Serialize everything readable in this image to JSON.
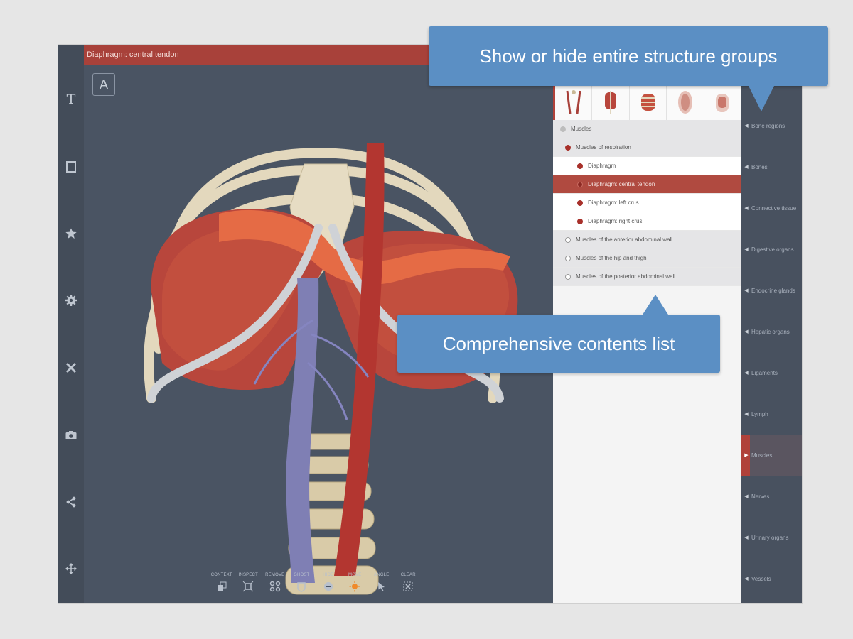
{
  "title_bar": {
    "label": "Diaphragm: central tendon"
  },
  "toolbar_left": {
    "icons": [
      "text-icon",
      "box-icon",
      "star-icon",
      "gear-icon",
      "close-icon",
      "camera-icon",
      "share-icon",
      "move-icon"
    ],
    "text_glyph": "T"
  },
  "viewport": {
    "annotation_button": "A"
  },
  "bottom_tools": [
    {
      "label": "CONTEXT"
    },
    {
      "label": "INSPECT"
    },
    {
      "label": "REMOVE"
    },
    {
      "label": "GHOST"
    },
    {
      "label": "HIDE"
    },
    {
      "label": "MOVE"
    },
    {
      "label": "ANGLE"
    },
    {
      "label": "CLEAR"
    }
  ],
  "contents": {
    "rows": [
      {
        "label": "Muscles",
        "level": 0
      },
      {
        "label": "Muscles of respiration",
        "level": 1
      },
      {
        "label": "Diaphragm",
        "level": 2
      },
      {
        "label": "Diaphragm: central tendon",
        "level": 2,
        "selected": true
      },
      {
        "label": "Diaphragm: left crus",
        "level": 2
      },
      {
        "label": "Diaphragm: right crus",
        "level": 2
      },
      {
        "label": "Muscles of the anterior abdominal wall",
        "level": 1
      },
      {
        "label": "Muscles of the hip and thigh",
        "level": 1
      },
      {
        "label": "Muscles of the posterior abdominal wall",
        "level": 1
      }
    ]
  },
  "groups": [
    {
      "label": "Bone regions"
    },
    {
      "label": "Bones"
    },
    {
      "label": "Connective tissue"
    },
    {
      "label": "Digestive organs"
    },
    {
      "label": "Endocrine glands"
    },
    {
      "label": "Hepatic organs"
    },
    {
      "label": "Ligaments"
    },
    {
      "label": "Lymph"
    },
    {
      "label": "Muscles",
      "active": true
    },
    {
      "label": "Nerves"
    },
    {
      "label": "Urinary organs"
    },
    {
      "label": "Vessels"
    }
  ],
  "callouts": {
    "top": "Show or hide entire structure groups",
    "middle": "Comprehensive contents list"
  },
  "colors": {
    "accent": "#b0413a",
    "callout": "#5b8fc4",
    "background": "#48515f"
  }
}
